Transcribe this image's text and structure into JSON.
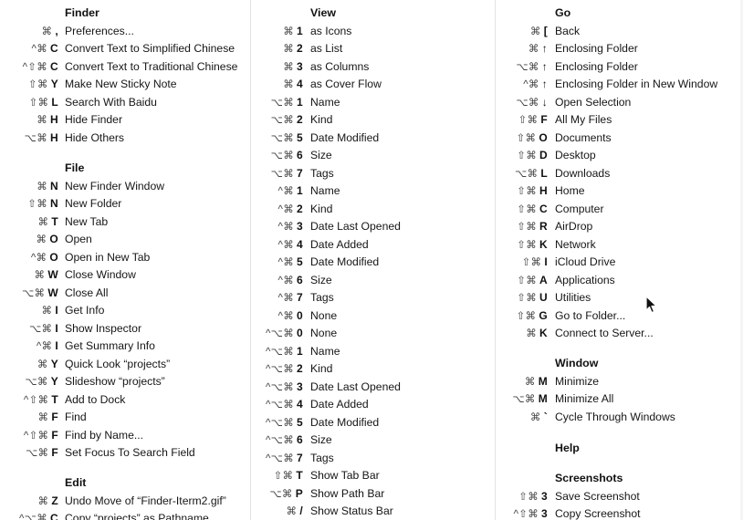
{
  "col1": {
    "finder": {
      "title": "Finder",
      "items": [
        {
          "mods": "⌘",
          "key": ",",
          "label": "Preferences..."
        },
        {
          "mods": "^⌘",
          "key": "C",
          "label": "Convert Text to Simplified Chinese"
        },
        {
          "mods": "^⇧⌘",
          "key": "C",
          "label": "Convert Text to Traditional Chinese"
        },
        {
          "mods": "⇧⌘",
          "key": "Y",
          "label": "Make New Sticky Note"
        },
        {
          "mods": "⇧⌘",
          "key": "L",
          "label": "Search With Baidu"
        },
        {
          "mods": "⌘",
          "key": "H",
          "label": "Hide Finder"
        },
        {
          "mods": "⌥⌘",
          "key": "H",
          "label": "Hide Others"
        }
      ]
    },
    "file": {
      "title": "File",
      "items": [
        {
          "mods": "⌘",
          "key": "N",
          "label": "New Finder Window"
        },
        {
          "mods": "⇧⌘",
          "key": "N",
          "label": "New Folder"
        },
        {
          "mods": "⌘",
          "key": "T",
          "label": "New Tab"
        },
        {
          "mods": "⌘",
          "key": "O",
          "label": "Open"
        },
        {
          "mods": "^⌘",
          "key": "O",
          "label": "Open in New Tab"
        },
        {
          "mods": "⌘",
          "key": "W",
          "label": "Close Window"
        },
        {
          "mods": "⌥⌘",
          "key": "W",
          "label": "Close All"
        },
        {
          "mods": "⌘",
          "key": "I",
          "label": "Get Info"
        },
        {
          "mods": "⌥⌘",
          "key": "I",
          "label": "Show Inspector"
        },
        {
          "mods": "^⌘",
          "key": "I",
          "label": "Get Summary Info"
        },
        {
          "mods": "⌘",
          "key": "Y",
          "label": "Quick Look “projects”"
        },
        {
          "mods": "⌥⌘",
          "key": "Y",
          "label": "Slideshow “projects”"
        },
        {
          "mods": "^⇧⌘",
          "key": "T",
          "label": "Add to Dock"
        },
        {
          "mods": "⌘",
          "key": "F",
          "label": "Find"
        },
        {
          "mods": "^⇧⌘",
          "key": "F",
          "label": "Find by Name..."
        },
        {
          "mods": "⌥⌘",
          "key": "F",
          "label": "Set Focus To Search Field"
        }
      ]
    },
    "edit": {
      "title": "Edit",
      "items": [
        {
          "mods": "⌘",
          "key": "Z",
          "label": "Undo Move of “Finder-Iterm2.gif”"
        },
        {
          "mods": "^⌥⌘",
          "key": "C",
          "label": "Copy “projects” as Pathname"
        }
      ]
    }
  },
  "col2": {
    "view": {
      "title": "View",
      "items": [
        {
          "mods": "⌘",
          "key": "1",
          "label": "as Icons"
        },
        {
          "mods": "⌘",
          "key": "2",
          "label": "as List"
        },
        {
          "mods": "⌘",
          "key": "3",
          "label": "as Columns"
        },
        {
          "mods": "⌘",
          "key": "4",
          "label": "as Cover Flow"
        },
        {
          "mods": "⌥⌘",
          "key": "1",
          "label": "Name"
        },
        {
          "mods": "⌥⌘",
          "key": "2",
          "label": "Kind"
        },
        {
          "mods": "⌥⌘",
          "key": "5",
          "label": "Date Modified"
        },
        {
          "mods": "⌥⌘",
          "key": "6",
          "label": "Size"
        },
        {
          "mods": "⌥⌘",
          "key": "7",
          "label": "Tags"
        },
        {
          "mods": "^⌘",
          "key": "1",
          "label": "Name"
        },
        {
          "mods": "^⌘",
          "key": "2",
          "label": "Kind"
        },
        {
          "mods": "^⌘",
          "key": "3",
          "label": "Date Last Opened"
        },
        {
          "mods": "^⌘",
          "key": "4",
          "label": "Date Added"
        },
        {
          "mods": "^⌘",
          "key": "5",
          "label": "Date Modified"
        },
        {
          "mods": "^⌘",
          "key": "6",
          "label": "Size"
        },
        {
          "mods": "^⌘",
          "key": "7",
          "label": "Tags"
        },
        {
          "mods": "^⌘",
          "key": "0",
          "label": "None"
        },
        {
          "mods": "^⌥⌘",
          "key": "0",
          "label": "None"
        },
        {
          "mods": "^⌥⌘",
          "key": "1",
          "label": "Name"
        },
        {
          "mods": "^⌥⌘",
          "key": "2",
          "label": "Kind"
        },
        {
          "mods": "^⌥⌘",
          "key": "3",
          "label": "Date Last Opened"
        },
        {
          "mods": "^⌥⌘",
          "key": "4",
          "label": "Date Added"
        },
        {
          "mods": "^⌥⌘",
          "key": "5",
          "label": "Date Modified"
        },
        {
          "mods": "^⌥⌘",
          "key": "6",
          "label": "Size"
        },
        {
          "mods": "^⌥⌘",
          "key": "7",
          "label": "Tags"
        },
        {
          "mods": "⇧⌘",
          "key": "T",
          "label": "Show Tab Bar"
        },
        {
          "mods": "⌥⌘",
          "key": "P",
          "label": "Show Path Bar"
        },
        {
          "mods": "⌘",
          "key": "/",
          "label": "Show Status Bar"
        }
      ]
    }
  },
  "col3": {
    "go": {
      "title": "Go",
      "items": [
        {
          "mods": "⌘",
          "key": "[",
          "label": "Back"
        },
        {
          "mods": "⌘",
          "key": "↑",
          "label": "Enclosing Folder"
        },
        {
          "mods": "⌥⌘",
          "key": "↑",
          "label": "Enclosing Folder"
        },
        {
          "mods": "^⌘",
          "key": "↑",
          "label": "Enclosing Folder in New Window"
        },
        {
          "mods": "⌥⌘",
          "key": "↓",
          "label": "Open Selection"
        },
        {
          "mods": "⇧⌘",
          "key": "F",
          "label": "All My Files"
        },
        {
          "mods": "⇧⌘",
          "key": "O",
          "label": "Documents"
        },
        {
          "mods": "⇧⌘",
          "key": "D",
          "label": "Desktop"
        },
        {
          "mods": "⌥⌘",
          "key": "L",
          "label": "Downloads"
        },
        {
          "mods": "⇧⌘",
          "key": "H",
          "label": "Home"
        },
        {
          "mods": "⇧⌘",
          "key": "C",
          "label": "Computer"
        },
        {
          "mods": "⇧⌘",
          "key": "R",
          "label": "AirDrop"
        },
        {
          "mods": "⇧⌘",
          "key": "K",
          "label": "Network"
        },
        {
          "mods": "⇧⌘",
          "key": "I",
          "label": "iCloud Drive"
        },
        {
          "mods": "⇧⌘",
          "key": "A",
          "label": "Applications"
        },
        {
          "mods": "⇧⌘",
          "key": "U",
          "label": "Utilities"
        },
        {
          "mods": "⇧⌘",
          "key": "G",
          "label": "Go to Folder..."
        },
        {
          "mods": "⌘",
          "key": "K",
          "label": "Connect to Server..."
        }
      ]
    },
    "window": {
      "title": "Window",
      "items": [
        {
          "mods": "⌘",
          "key": "M",
          "label": "Minimize"
        },
        {
          "mods": "⌥⌘",
          "key": "M",
          "label": "Minimize All"
        },
        {
          "mods": "⌘",
          "key": "`",
          "label": "Cycle Through Windows"
        }
      ]
    },
    "help": {
      "title": "Help",
      "items": []
    },
    "screenshots": {
      "title": "Screenshots",
      "items": [
        {
          "mods": "⇧⌘",
          "key": "3",
          "label": "Save Screenshot"
        },
        {
          "mods": "^⇧⌘",
          "key": "3",
          "label": "Copy Screenshot"
        }
      ]
    }
  }
}
